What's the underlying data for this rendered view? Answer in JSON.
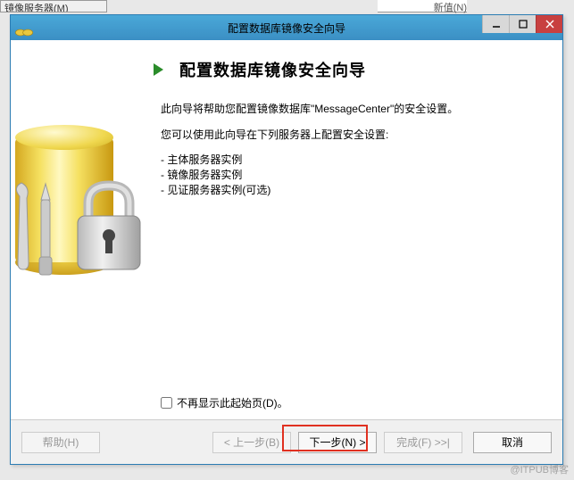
{
  "background": {
    "partial_label": "镜像服务器(M)",
    "partial_field": "新值(N)"
  },
  "window": {
    "title": "配置数据库镜像安全向导"
  },
  "page": {
    "heading": "配置数据库镜像安全向导",
    "intro1": "此向导将帮助您配置镜像数据库\"MessageCenter\"的安全设置。",
    "intro2": "您可以使用此向导在下列服务器上配置安全设置:",
    "servers": [
      "主体服务器实例",
      "镜像服务器实例",
      "见证服务器实例(可选)"
    ],
    "dont_show_label": "不再显示此起始页(D)。"
  },
  "buttons": {
    "help": "帮助(H)",
    "back": "< 上一步(B)",
    "next": "下一步(N) >",
    "finish": "完成(F) >>|",
    "cancel": "取消"
  },
  "watermark": "@ITPUB博客"
}
